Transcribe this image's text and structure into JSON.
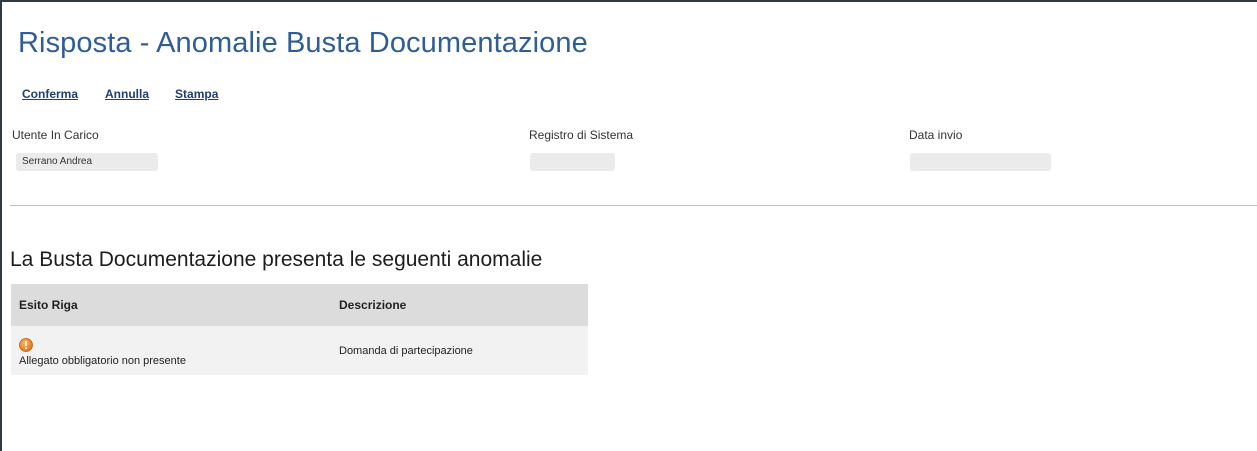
{
  "page": {
    "title": "Risposta - Anomalie Busta Documentazione"
  },
  "toolbar": {
    "confirm_label": "Conferma",
    "cancel_label": "Annulla",
    "print_label": "Stampa"
  },
  "fields": {
    "assigned_user": {
      "label": "Utente In Carico",
      "value": "Serrano Andrea"
    },
    "system_register": {
      "label": "Registro di Sistema",
      "value": ""
    },
    "send_date": {
      "label": "Data invio",
      "value": ""
    }
  },
  "anomalies": {
    "section_title": "La Busta Documentazione presenta le seguenti anomalie",
    "columns": [
      "Esito Riga",
      "Descrizione"
    ],
    "rows": [
      {
        "status_icon": "warning-icon",
        "status_text": "Allegato obbligatorio non presente",
        "description": "Domanda di partecipazione"
      }
    ]
  },
  "colors": {
    "title": "#2e5d98",
    "link": "#1f3f73",
    "warning": "#f08a24"
  }
}
